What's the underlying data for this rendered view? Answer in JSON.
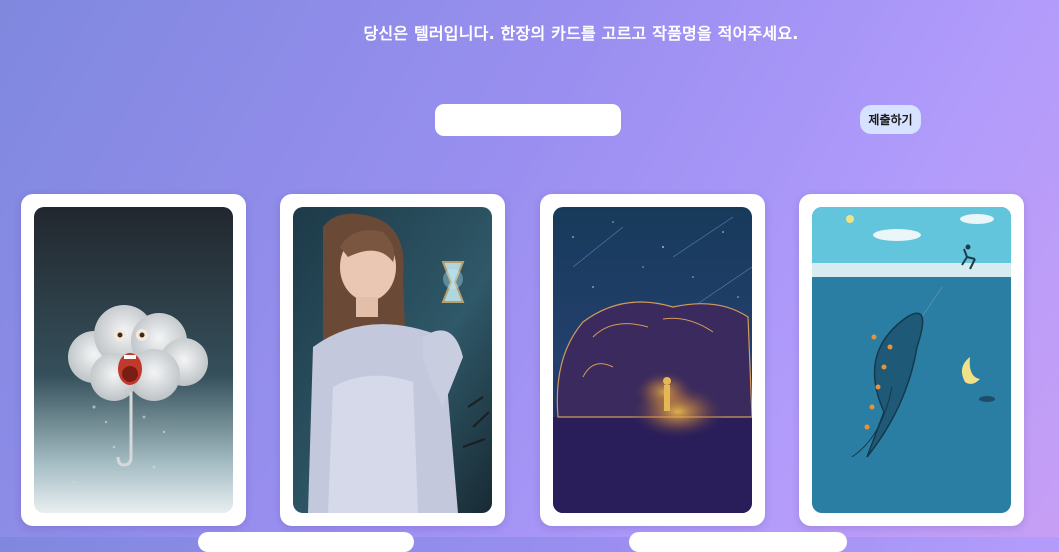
{
  "header": {
    "title": "당신은 텔러입니다. 한장의 카드를 고르고 작품명을 적어주세요."
  },
  "form": {
    "title_input_value": "",
    "submit_label": "제출하기"
  },
  "cards": [
    {
      "subject": "cloud-umbrella"
    },
    {
      "subject": "girl-hourglass"
    },
    {
      "subject": "hand-cave"
    },
    {
      "subject": "whale-moon"
    }
  ],
  "colors": {
    "background_start": "#7f88de",
    "background_end": "#c79ff5",
    "submit_bg": "#d6e2ff"
  }
}
